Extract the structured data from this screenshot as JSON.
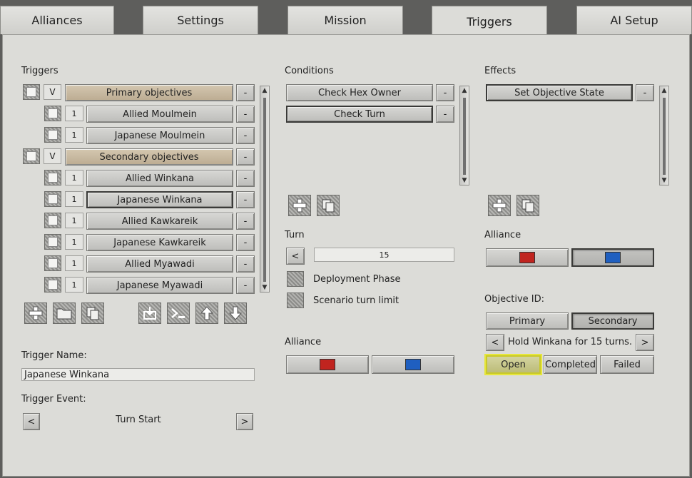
{
  "tabs": [
    {
      "label": "Alliances"
    },
    {
      "label": "Settings"
    },
    {
      "label": "Mission"
    },
    {
      "label": "Triggers"
    },
    {
      "label": "AI Setup"
    }
  ],
  "triggers": {
    "header": "Triggers",
    "rows": [
      {
        "label": "Primary objectives",
        "type": "group",
        "mark": "V"
      },
      {
        "label": "Allied Moulmein",
        "type": "item",
        "count": "1"
      },
      {
        "label": "Japanese Moulmein",
        "type": "item",
        "count": "1"
      },
      {
        "label": "Secondary objectives",
        "type": "group",
        "mark": "V"
      },
      {
        "label": "Allied Winkana",
        "type": "item",
        "count": "1"
      },
      {
        "label": "Japanese Winkana",
        "type": "item",
        "count": "1"
      },
      {
        "label": "Allied Kawkareik",
        "type": "item",
        "count": "1"
      },
      {
        "label": "Japanese Kawkareik",
        "type": "item",
        "count": "1"
      },
      {
        "label": "Allied Myawadi",
        "type": "item",
        "count": "1"
      },
      {
        "label": "Japanese Myawadi",
        "type": "item",
        "count": "1"
      }
    ],
    "remove_label": "-",
    "name_label": "Trigger Name:",
    "name_value": "Japanese Winkana",
    "event_label": "Trigger Event:",
    "event_value": "Turn Start",
    "prev": "<",
    "next": ">"
  },
  "conditions": {
    "header": "Conditions",
    "items": [
      {
        "label": "Check Hex Owner"
      },
      {
        "label": "Check Turn"
      }
    ],
    "remove_label": "-",
    "turn_label": "Turn",
    "turn_value": "15",
    "prev": "<",
    "deployment_label": "Deployment Phase",
    "turn_limit_label": "Scenario turn limit",
    "alliance_label": "Alliance"
  },
  "effects": {
    "header": "Effects",
    "items": [
      {
        "label": "Set Objective State"
      }
    ],
    "remove_label": "-",
    "alliance_label": "Alliance",
    "objective_id_label": "Objective ID:",
    "primary": "Primary",
    "secondary": "Secondary",
    "objective_text": "Hold Winkana for 15 turns.",
    "prev": "<",
    "next": ">",
    "states": {
      "open": "Open",
      "completed": "Completed",
      "failed": "Failed"
    }
  },
  "colors": {
    "red": "#c0241f",
    "blue": "#1f5fc0",
    "highlight": "#e6e63a"
  }
}
